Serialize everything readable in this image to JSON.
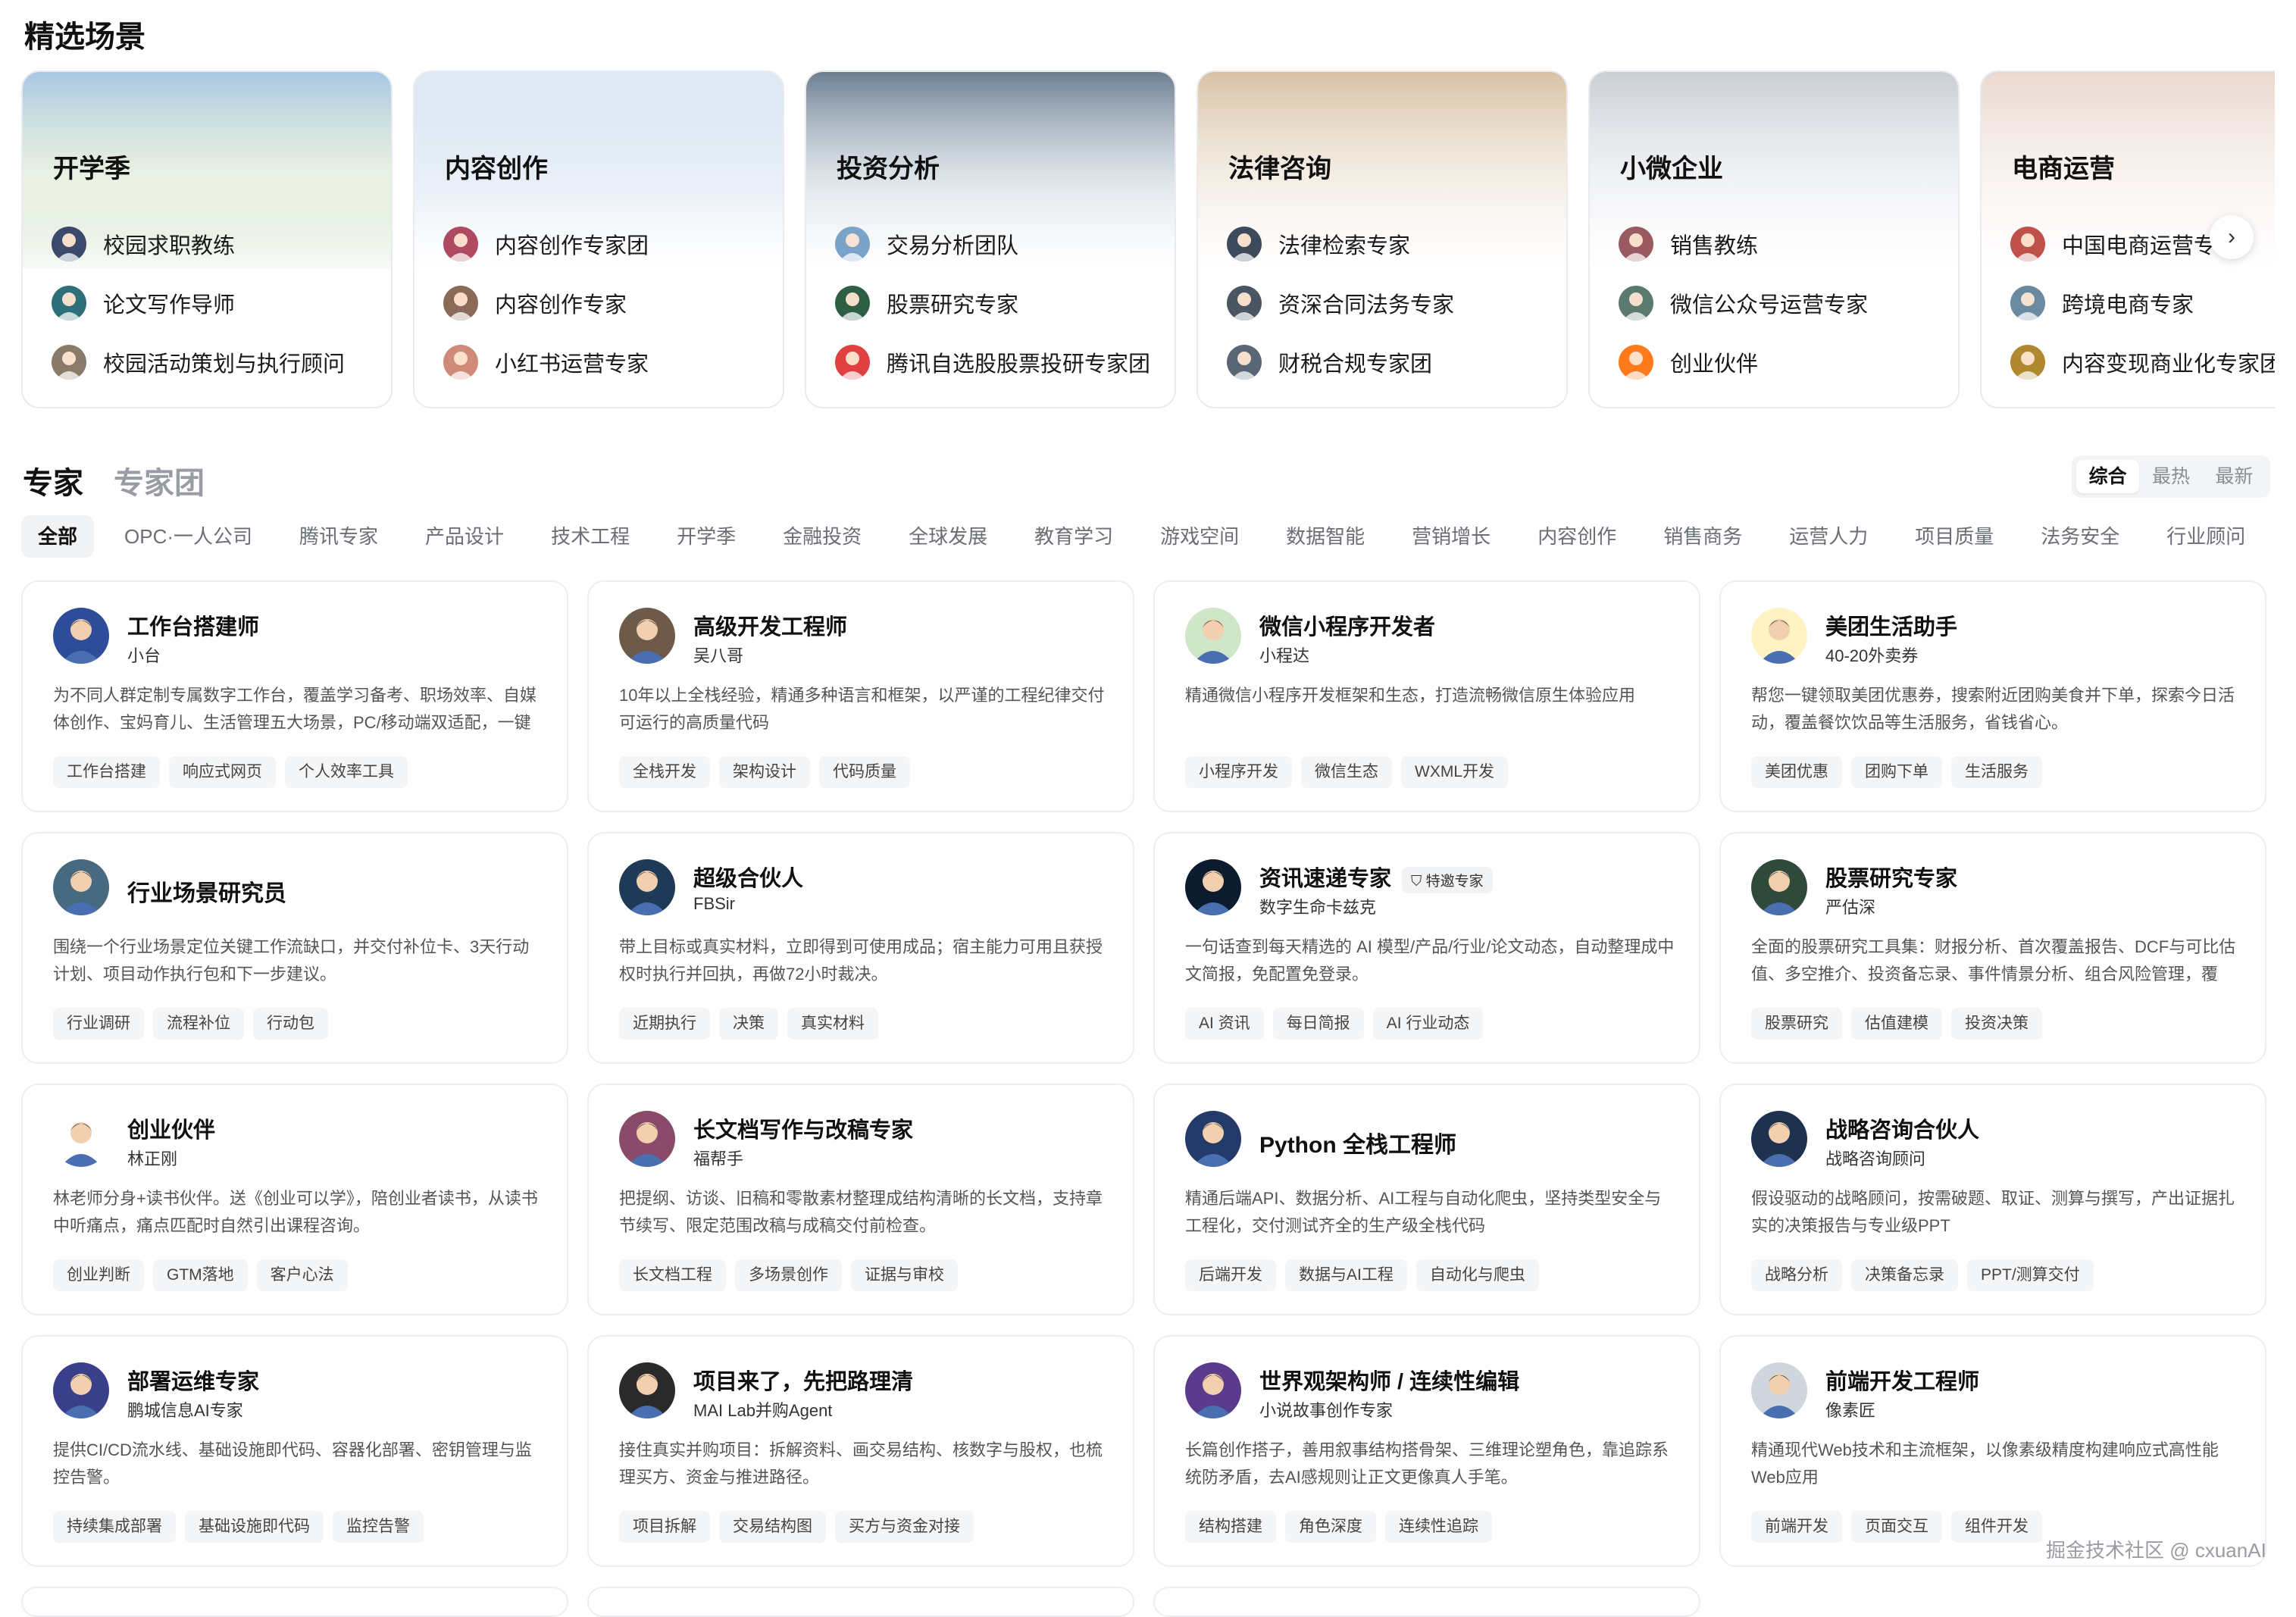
{
  "featured": {
    "title": "精选场景",
    "scenes": [
      {
        "title": "开学季",
        "items": [
          "校园求职教练",
          "论文写作导师",
          "校园活动策划与执行顾问"
        ]
      },
      {
        "title": "内容创作",
        "items": [
          "内容创作专家团",
          "内容创作专家",
          "小红书运营专家"
        ]
      },
      {
        "title": "投资分析",
        "items": [
          "交易分析团队",
          "股票研究专家",
          "腾讯自选股股票投研专家团"
        ]
      },
      {
        "title": "法律咨询",
        "items": [
          "法律检索专家",
          "资深合同法务专家",
          "财税合规专家团"
        ]
      },
      {
        "title": "小微企业",
        "items": [
          "销售教练",
          "微信公众号运营专家",
          "创业伙伴"
        ]
      },
      {
        "title": "电商运营",
        "items": [
          "中国电商运营专",
          "跨境电商专家",
          "内容变现商业化专家团"
        ]
      }
    ]
  },
  "tabs": {
    "experts": "专家",
    "teams": "专家团"
  },
  "sort": [
    "综合",
    "最热",
    "最新"
  ],
  "filters": [
    "全部",
    "OPC·一人公司",
    "腾讯专家",
    "产品设计",
    "技术工程",
    "开学季",
    "金融投资",
    "全球发展",
    "教育学习",
    "游戏空间",
    "数据智能",
    "营销增长",
    "内容创作",
    "销售商务",
    "运营人力",
    "项目质量",
    "法务安全",
    "行业顾问"
  ],
  "cards": [
    {
      "name": "工作台搭建师",
      "sub": "小台",
      "desc": "为不同人群定制专属数字工作台，覆盖学习备考、职场效率、自媒体创作、宝妈育儿、生活管理五大场景，PC/移动端双适配，一键部...",
      "tags": [
        "工作台搭建",
        "响应式网页",
        "个人效率工具"
      ]
    },
    {
      "name": "高级开发工程师",
      "sub": "吴八哥",
      "desc": "10年以上全栈经验，精通多种语言和框架，以严谨的工程纪律交付可运行的高质量代码",
      "tags": [
        "全栈开发",
        "架构设计",
        "代码质量"
      ]
    },
    {
      "name": "微信小程序开发者",
      "sub": "小程达",
      "desc": "精通微信小程序开发框架和生态，打造流畅微信原生体验应用",
      "tags": [
        "小程序开发",
        "微信生态",
        "WXML开发"
      ]
    },
    {
      "name": "美团生活助手",
      "sub": "40-20外卖券",
      "desc": "帮您一键领取美团优惠券，搜索附近团购美食并下单，探索今日活动，覆盖餐饮饮品等生活服务，省钱省心。",
      "tags": [
        "美团优惠",
        "团购下单",
        "生活服务"
      ]
    },
    {
      "name": "行业场景研究员",
      "sub": "",
      "desc": "围绕一个行业场景定位关键工作流缺口，并交付补位卡、3天行动计划、项目动作执行包和下一步建议。",
      "tags": [
        "行业调研",
        "流程补位",
        "行动包"
      ]
    },
    {
      "name": "超级合伙人",
      "sub": "FBSir",
      "desc": "带上目标或真实材料，立即得到可使用成品；宿主能力可用且获授权时执行并回执，再做72小时裁决。",
      "tags": [
        "近期执行",
        "决策",
        "真实材料"
      ]
    },
    {
      "name": "资讯速递专家",
      "sub": "数字生命卡兹克",
      "badge": "特邀专家",
      "desc": "一句话查到每天精选的 AI 模型/产品/行业/论文动态，自动整理成中文简报，免配置免登录。",
      "tags": [
        "AI 资讯",
        "每日简报",
        "AI 行业动态"
      ]
    },
    {
      "name": "股票研究专家",
      "sub": "严估深",
      "desc": "全面的股票研究工具集：财报分析、首次覆盖报告、DCF与可比估值、多空推介、投资备忘录、事件情景分析、组合风险管理，覆盖...",
      "tags": [
        "股票研究",
        "估值建模",
        "投资决策"
      ]
    },
    {
      "name": "创业伙伴",
      "sub": "林正刚",
      "desc": "林老师分身+读书伙伴。送《创业可以学》，陪创业者读书，从读书中听痛点，痛点匹配时自然引出课程咨询。",
      "tags": [
        "创业判断",
        "GTM落地",
        "客户心法"
      ]
    },
    {
      "name": "长文档写作与改稿专家",
      "sub": "福帮手",
      "desc": "把提纲、访谈、旧稿和零散素材整理成结构清晰的长文档，支持章节续写、限定范围改稿与成稿交付前检查。",
      "tags": [
        "长文档工程",
        "多场景创作",
        "证据与审校"
      ]
    },
    {
      "name": "Python 全栈工程师",
      "sub": "",
      "desc": "精通后端API、数据分析、AI工程与自动化爬虫，坚持类型安全与工程化，交付测试齐全的生产级全栈代码",
      "tags": [
        "后端开发",
        "数据与AI工程",
        "自动化与爬虫"
      ]
    },
    {
      "name": "战略咨询合伙人",
      "sub": "战略咨询顾问",
      "desc": "假设驱动的战略顾问，按需破题、取证、测算与撰写，产出证据扎实的决策报告与专业级PPT",
      "tags": [
        "战略分析",
        "决策备忘录",
        "PPT/测算交付"
      ]
    },
    {
      "name": "部署运维专家",
      "sub": "鹏城信息AI专家",
      "desc": "提供CI/CD流水线、基础设施即代码、容器化部署、密钥管理与监控告警。",
      "tags": [
        "持续集成部署",
        "基础设施即代码",
        "监控告警"
      ]
    },
    {
      "name": "项目来了，先把路理清",
      "sub": "MAI Lab并购Agent",
      "desc": "接住真实并购项目：拆解资料、画交易结构、核数字与股权，也梳理买方、资金与推进路径。",
      "tags": [
        "项目拆解",
        "交易结构图",
        "买方与资金对接"
      ]
    },
    {
      "name": "世界观架构师 / 连续性编辑",
      "sub": "小说故事创作专家",
      "desc": "长篇创作搭子，善用叙事结构搭骨架、三维理论塑角色，靠追踪系统防矛盾，去AI感规则让正文更像真人手笔。",
      "tags": [
        "结构搭建",
        "角色深度",
        "连续性追踪"
      ]
    },
    {
      "name": "前端开发工程师",
      "sub": "像素匠",
      "desc": "精通现代Web技术和主流框架，以像素级精度构建响应式高性能Web应用",
      "tags": [
        "前端开发",
        "页面交互",
        "组件开发"
      ]
    }
  ],
  "watermark": "掘金技术社区 @ cxuanAI",
  "colors": {
    "accent": "#111111",
    "muted": "#9a9ca3",
    "tagBg": "#f4f5f7"
  }
}
